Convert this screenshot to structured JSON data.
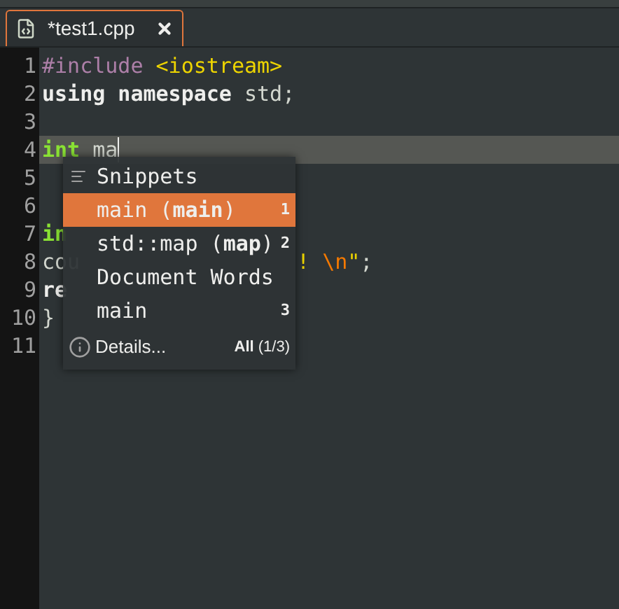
{
  "tab": {
    "title": "*test1.cpp",
    "selected": true
  },
  "lines": [
    {
      "number": "1",
      "current": false,
      "tokens": [
        {
          "text": "#include ",
          "kind": "preproc"
        },
        {
          "text": "<iostream>",
          "kind": "string"
        }
      ]
    },
    {
      "number": "2",
      "current": false,
      "tokens": [
        {
          "text": "using namespace ",
          "kind": "keyword"
        },
        {
          "text": "std;",
          "kind": "plain"
        }
      ]
    },
    {
      "number": "3",
      "current": false
    },
    {
      "number": "4",
      "current": true,
      "tokens": [
        {
          "text": "int ",
          "kind": "type"
        },
        {
          "text": "ma",
          "kind": "plain"
        }
      ]
    },
    {
      "number": "5",
      "current": false
    },
    {
      "number": "6",
      "current": false
    },
    {
      "number": "7",
      "current": false,
      "tokens": [
        {
          "text": "in",
          "kind": "type"
        }
      ]
    },
    {
      "number": "8",
      "current": false,
      "tokens": [
        {
          "text": "cou",
          "kind": "plain"
        }
      ],
      "tail": [
        {
          "text": "! ",
          "kind": "string"
        },
        {
          "text": "\\n",
          "kind": "escape"
        },
        {
          "text": "\"",
          "kind": "string"
        },
        {
          "text": ";",
          "kind": "plain"
        }
      ]
    },
    {
      "number": "9",
      "current": false,
      "tokens": [
        {
          "text": "re",
          "kind": "keyword"
        }
      ]
    },
    {
      "number": "10",
      "current": false,
      "tokens": [
        {
          "text": "}",
          "kind": "plain"
        }
      ]
    },
    {
      "number": "11",
      "current": false
    }
  ],
  "completion": {
    "rows": [
      {
        "kind": "header",
        "label": "Snippets",
        "icon": true
      },
      {
        "kind": "item",
        "label": "main (**main**)",
        "count": "1",
        "selected": true
      },
      {
        "kind": "item",
        "label": "std::map (**map**)",
        "count": "2",
        "selected": false
      },
      {
        "kind": "header",
        "label": "Document Words",
        "icon": false
      },
      {
        "kind": "item",
        "label": "main",
        "count": "3",
        "selected": false
      }
    ],
    "details": "Details...",
    "scope": "**All** (1/3)"
  }
}
